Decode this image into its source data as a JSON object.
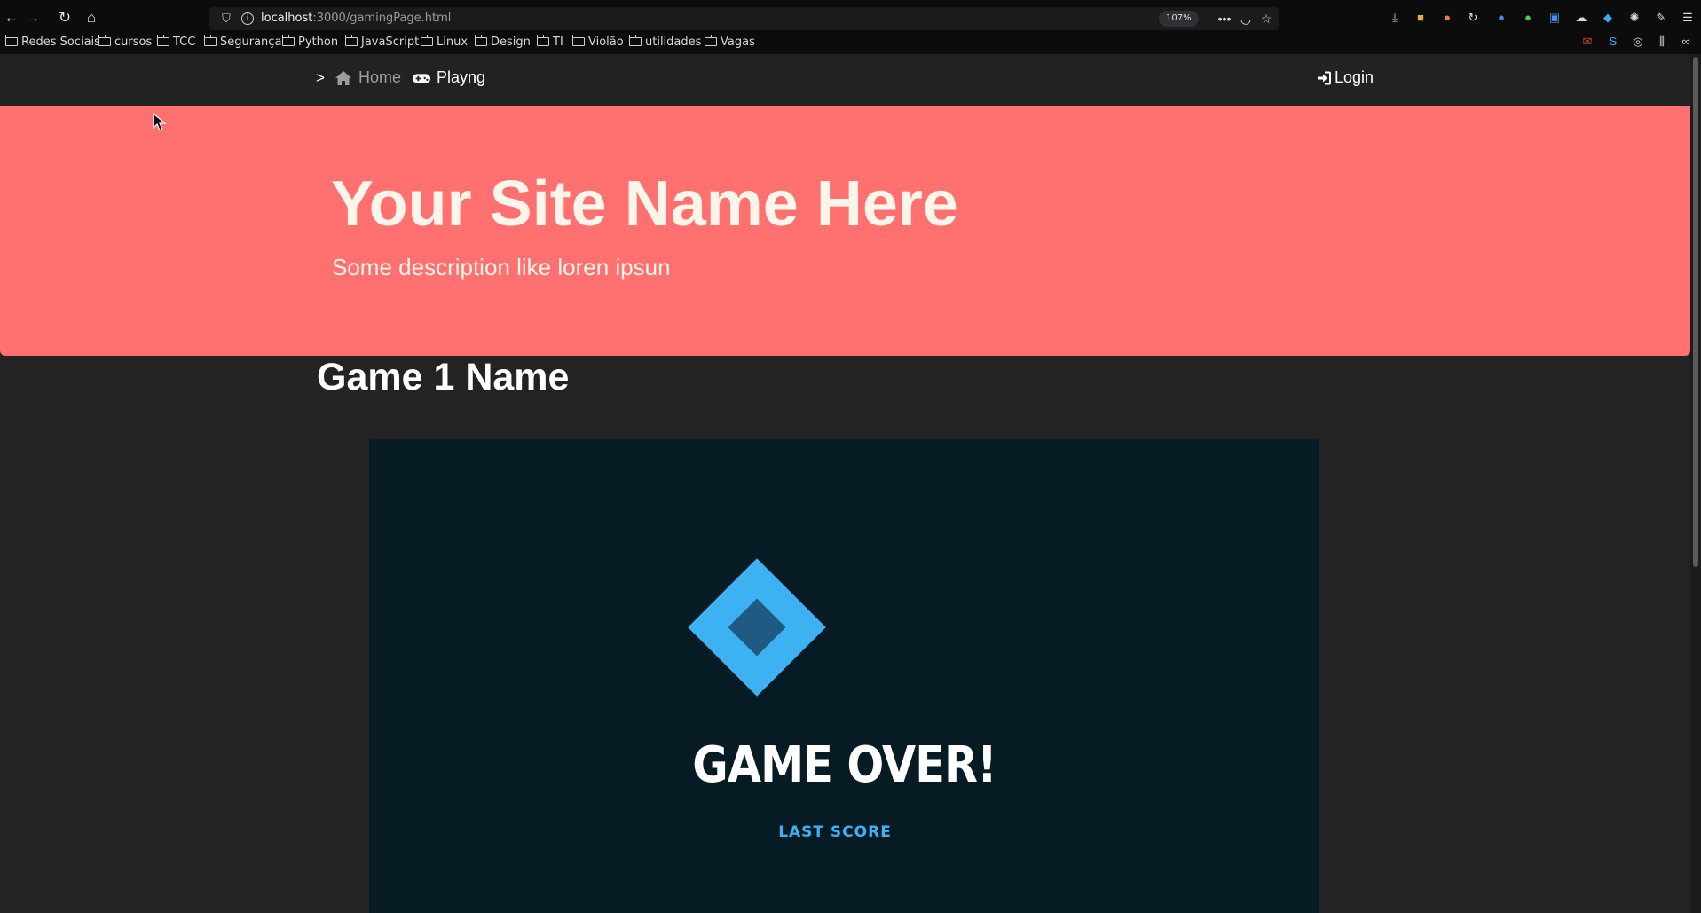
{
  "browser": {
    "url_host": "localhost",
    "url_path": ":3000/gamingPage.html",
    "zoom": "107%",
    "bookmarks": [
      "Redes Sociais",
      "cursos",
      "TCC",
      "Segurança",
      "Python",
      "JavaScript",
      "Linux",
      "Design",
      "TI",
      "Violão",
      "utilidades",
      "Vagas"
    ],
    "icons": [
      "back-icon",
      "forward-icon",
      "reload-icon",
      "home-icon",
      "shield-icon",
      "info-icon",
      "more-icon",
      "pocket-icon",
      "star-icon",
      "download-icon",
      "menu-icon"
    ]
  },
  "navbar": {
    "brand": ">",
    "home": "Home",
    "playng": "Playng",
    "login": "Login"
  },
  "hero": {
    "title": "Your Site Name Here",
    "description": "Some description like loren ipsun"
  },
  "game": {
    "name": "Game 1 Name",
    "status": "GAME OVER!",
    "last_score_label": "LAST SCORE"
  },
  "colors": {
    "hero_bg": "#ff7070",
    "game_bg": "#071b24",
    "accent": "#3db2f2"
  }
}
